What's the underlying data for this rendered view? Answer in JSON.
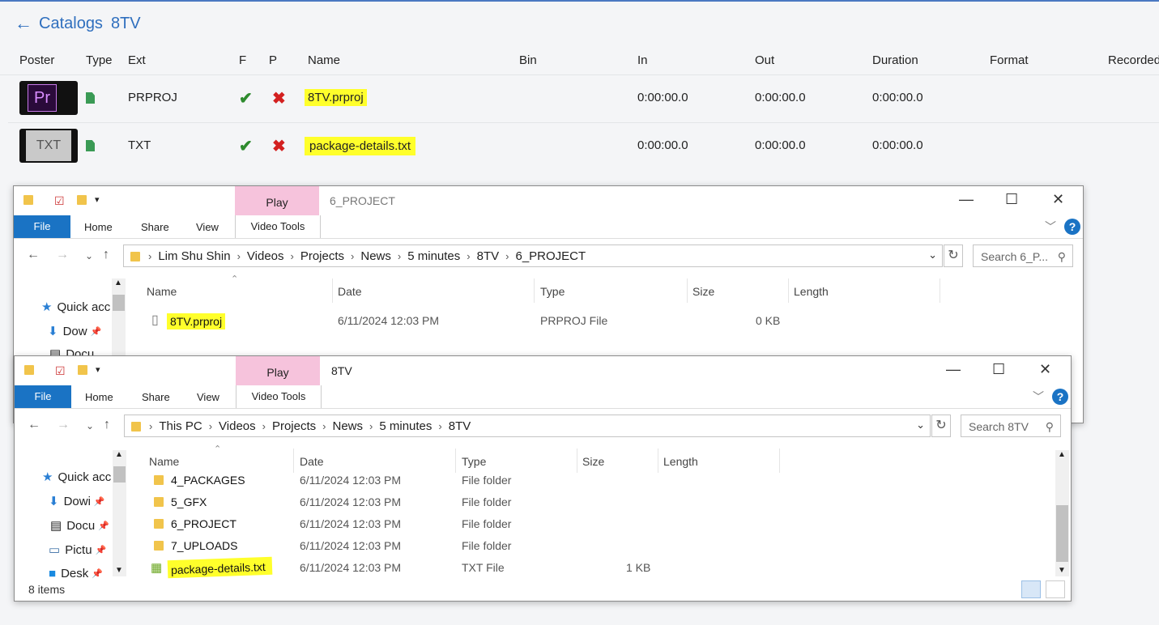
{
  "catalog": {
    "back_icon": "arrow-left-icon",
    "title": "Catalogs",
    "subtitle": "8TV",
    "columns": [
      "Poster",
      "Type",
      "Ext",
      "F",
      "P",
      "Name",
      "Bin",
      "In",
      "Out",
      "Duration",
      "Format",
      "Recorded"
    ],
    "rows": [
      {
        "poster": "Pr",
        "ext": "PRPROJ",
        "name": "8TV.prproj",
        "in": "0:00:00.0",
        "out": "0:00:00.0",
        "duration": "0:00:00.0"
      },
      {
        "poster": "TXT",
        "ext": "TXT",
        "name": "package-details.txt",
        "in": "0:00:00.0",
        "out": "0:00:00.0",
        "duration": "0:00:00.0"
      }
    ],
    "check_glyph": "✔",
    "cross_glyph": "✖",
    "highlight_color": "#ffff2b"
  },
  "explorer1": {
    "title": "6_PROJECT",
    "play_tab": "Play",
    "ribbon": {
      "file": "File",
      "home": "Home",
      "share": "Share",
      "view": "View",
      "video_tools": "Video Tools"
    },
    "breadcrumb": [
      "Lim Shu Shin",
      "Videos",
      "Projects",
      "News",
      "5 minutes",
      "8TV",
      "6_PROJECT"
    ],
    "search_placeholder": "Search 6_P...",
    "columns": {
      "name": "Name",
      "date": "Date",
      "type": "Type",
      "size": "Size",
      "length": "Length"
    },
    "sidebar": [
      {
        "label": "Quick acc",
        "icon": "star-icon"
      },
      {
        "label": "Dow",
        "icon": "download-icon"
      },
      {
        "label": "Docu",
        "icon": "document-icon"
      }
    ],
    "files": [
      {
        "name": "8TV.prproj",
        "date": "6/11/2024 12:03 PM",
        "type": "PRPROJ File",
        "size": "0 KB"
      }
    ]
  },
  "explorer2": {
    "title": "8TV",
    "play_tab": "Play",
    "ribbon": {
      "file": "File",
      "home": "Home",
      "share": "Share",
      "view": "View",
      "video_tools": "Video Tools"
    },
    "breadcrumb": [
      "This PC",
      "Videos",
      "Projects",
      "News",
      "5 minutes",
      "8TV"
    ],
    "search_placeholder": "Search 8TV",
    "columns": {
      "name": "Name",
      "date": "Date",
      "type": "Type",
      "size": "Size",
      "length": "Length"
    },
    "sidebar": [
      {
        "label": "Quick acc",
        "icon": "star-icon"
      },
      {
        "label": "Dowi",
        "icon": "download-icon"
      },
      {
        "label": "Docu",
        "icon": "document-icon"
      },
      {
        "label": "Pictu",
        "icon": "picture-icon"
      },
      {
        "label": "Desk",
        "icon": "desktop-icon"
      }
    ],
    "files": [
      {
        "name": "4_PACKAGES",
        "date": "6/11/2024 12:03 PM",
        "type": "File folder",
        "size": ""
      },
      {
        "name": "5_GFX",
        "date": "6/11/2024 12:03 PM",
        "type": "File folder",
        "size": ""
      },
      {
        "name": "6_PROJECT",
        "date": "6/11/2024 12:03 PM",
        "type": "File folder",
        "size": ""
      },
      {
        "name": "7_UPLOADS",
        "date": "6/11/2024 12:03 PM",
        "type": "File folder",
        "size": ""
      },
      {
        "name": "package-details.txt",
        "date": "6/11/2024 12:03 PM",
        "type": "TXT File",
        "size": "1 KB"
      }
    ],
    "status": "8 items"
  }
}
